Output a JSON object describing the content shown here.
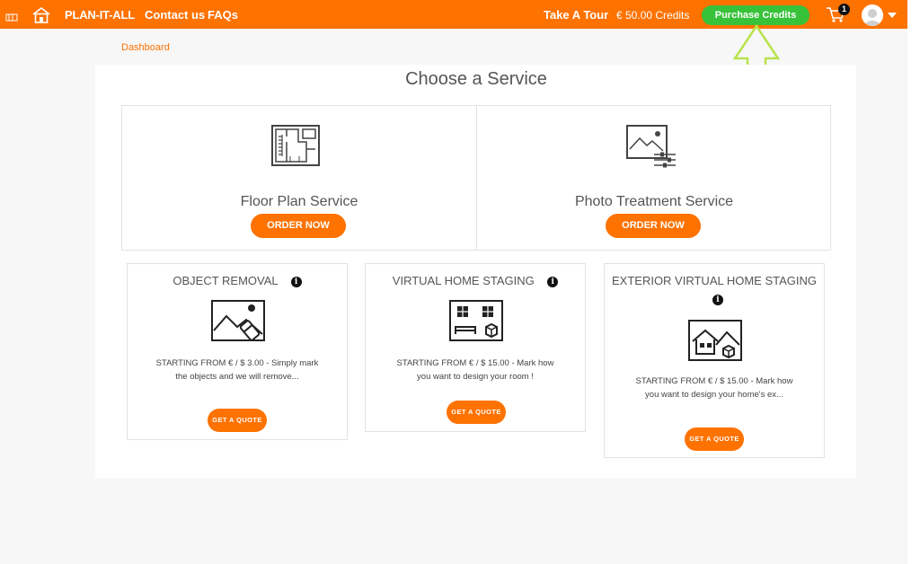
{
  "topbar": {
    "brand": "PLAN-IT-ALL",
    "nav": [
      "Contact us",
      "FAQs"
    ],
    "tour": "Take A Tour",
    "credits": "€ 50.00 Credits",
    "purchase": "Purchase Credits",
    "cart_count": "1",
    "colors": {
      "bar": "#fe7200",
      "purchase": "#37c23a"
    }
  },
  "breadcrumb": "Dashboard",
  "page_title": "Choose a Service",
  "services": [
    {
      "title": "Floor Plan Service",
      "button": "ORDER NOW",
      "icon": "floor-plan-icon"
    },
    {
      "title": "Photo Treatment Service",
      "button": "ORDER NOW",
      "icon": "photo-adjust-icon"
    }
  ],
  "cards": [
    {
      "title": "OBJECT REMOVAL",
      "desc": "STARTING FROM € / $ 3.00 - Simply mark the objects and we will remove...",
      "button": "GET A QUOTE",
      "icon": "object-removal-icon"
    },
    {
      "title": "VIRTUAL HOME STAGING",
      "desc": "STARTING FROM € / $ 15.00 - Mark how you want to design your room !",
      "button": "GET A QUOTE",
      "icon": "room-staging-icon"
    },
    {
      "title": "EXTERIOR VIRTUAL HOME STAGING",
      "desc": "STARTING FROM € / $ 15.00 - Mark how you want to design your home's ex...",
      "button": "GET A QUOTE",
      "icon": "exterior-staging-icon"
    }
  ],
  "info_glyph": "i"
}
